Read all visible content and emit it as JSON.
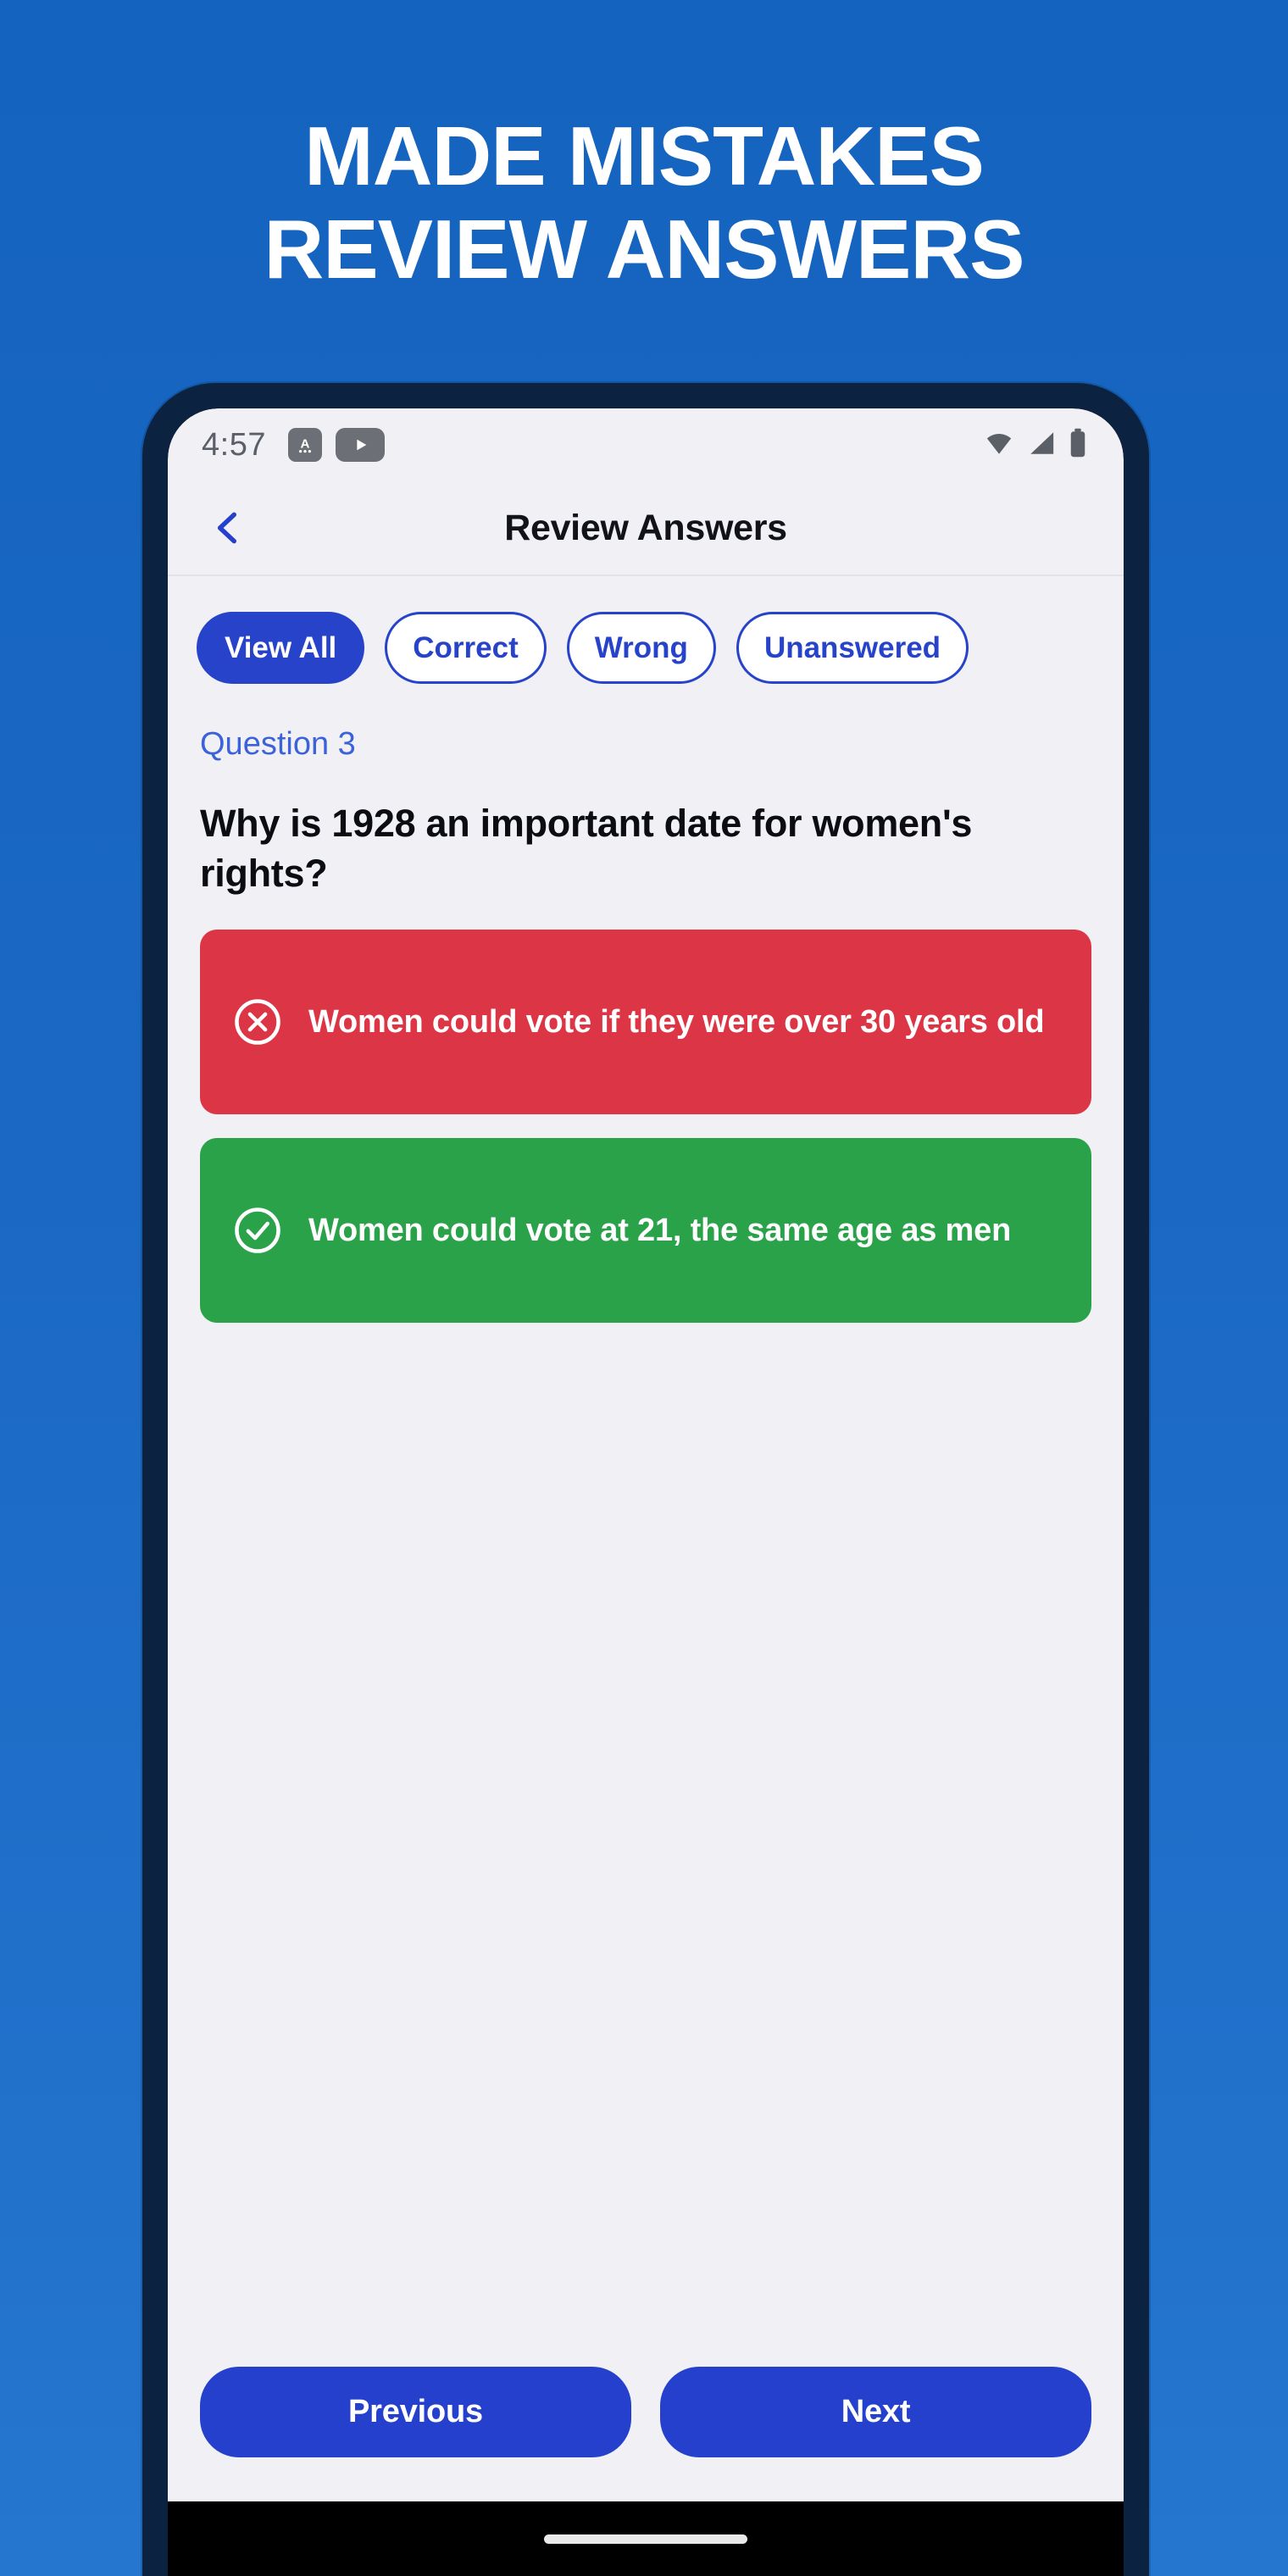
{
  "promo": {
    "line1": "MADE MISTAKES",
    "line2": "REVIEW ANSWERS",
    "background_top": "#1463BE",
    "background_bottom": "#2576CF",
    "text_color": "#FFFFFF"
  },
  "device": {
    "frame_color": "#0B2240",
    "screen_background": "#F1F1F5"
  },
  "statusbar": {
    "time": "4:57",
    "left_icons": [
      "keyboard-a-icon",
      "youtube-play-icon"
    ],
    "right_icons": [
      "wifi-icon",
      "cellular-signal-icon",
      "battery-icon"
    ]
  },
  "appbar": {
    "back_icon": "chevron-left-icon",
    "title": "Review Answers",
    "accent_color": "#2440CC"
  },
  "filters": {
    "active_index": 0,
    "items": [
      {
        "label": "View All",
        "active": true
      },
      {
        "label": "Correct",
        "active": false
      },
      {
        "label": "Wrong",
        "active": false
      },
      {
        "label": "Unanswered",
        "active": false
      }
    ],
    "accent_color": "#2743C9"
  },
  "question": {
    "number_label": "Question 3",
    "text": "Why is 1928 an important date for women's rights?",
    "label_color": "#3B62D8"
  },
  "options": [
    {
      "text": "Women could vote if they were over 30 years old",
      "state": "wrong",
      "icon": "x-circle-icon",
      "color": "#DC3545"
    },
    {
      "text": "Women could vote at 21, the same age as men",
      "state": "correct",
      "icon": "check-circle-icon",
      "color": "#2AA24A"
    }
  ],
  "footer": {
    "previous_label": "Previous",
    "next_label": "Next",
    "button_color": "#2440CC"
  }
}
